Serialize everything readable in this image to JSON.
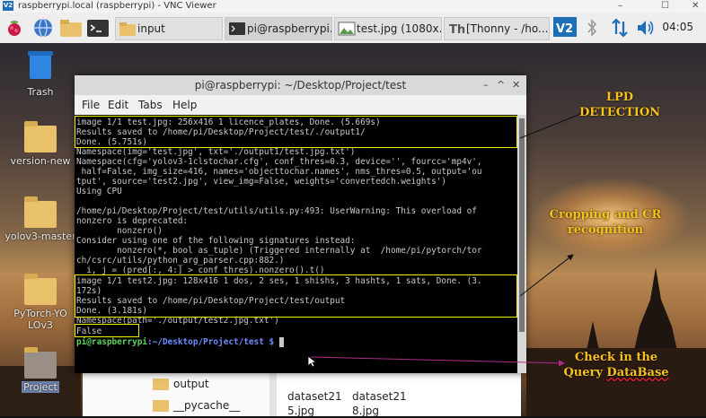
{
  "vnc": {
    "title": "raspberrypi.local (raspberrypi) - VNC Viewer",
    "logo": "V2",
    "minimize": "–",
    "maximize": "☐",
    "close": "✕"
  },
  "taskbar": {
    "buttons": [
      {
        "label": "input",
        "icon": "folder-icon"
      },
      {
        "label": "pi@raspberrypi...",
        "icon": "terminal-icon"
      },
      {
        "label": "test.jpg (1080x...",
        "icon": "image-icon"
      },
      {
        "label": "[Thonny - /ho...",
        "icon": "thonny-icon"
      }
    ],
    "clock": "04:05"
  },
  "desktop": {
    "icons": [
      {
        "label": "Trash"
      },
      {
        "label": "version-new"
      },
      {
        "label": "yolov3-master"
      },
      {
        "label": "PyTorch-YOLOv3"
      },
      {
        "label": "Project"
      }
    ]
  },
  "file_manager": {
    "folders": [
      "output",
      "__pycache__"
    ],
    "files": [
      "dataset215.jpg",
      "dataset218.jpg"
    ]
  },
  "terminal": {
    "title": "pi@raspberrypi: ~/Desktop/Project/test",
    "menu": [
      "File",
      "Edit",
      "Tabs",
      "Help"
    ],
    "lines": [
      "image 1/1 test.jpg: 256x416 1 licence_plates, Done. (5.669s)",
      "Results saved to /home/pi/Desktop/Project/test/./output1/",
      "Done. (5.751s)",
      "Namespace(img='test.jpg', txt='./output1/test.jpg.txt')",
      "Namespace(cfg='yolov3-1clstochar.cfg', conf_thres=0.3, device='', fourcc='mp4v',",
      " half=False, img_size=416, names='objecttochar.names', nms_thres=0.5, output='ou",
      "tput', source='test2.jpg', view_img=False, weights='convertedch.weights')",
      "Using CPU",
      "",
      "/home/pi/Desktop/Project/test/utils/utils.py:493: UserWarning: This overload of",
      "nonzero is deprecated:",
      "        nonzero()",
      "Consider using one of the following signatures instead:",
      "        nonzero(*, bool as_tuple) (Triggered internally at  /home/pi/pytorch/tor",
      "ch/csrc/utils/python_arg_parser.cpp:882.)",
      "  i, j = (pred[:, 4:] > conf_thres).nonzero().t()",
      "image 1/1 test2.jpg: 128x416 1 dos, 2 ses, 1 shishs, 3 hashts, 1 sats, Done. (3.",
      "172s)",
      "Results saved to /home/pi/Desktop/Project/test/output",
      "Done. (3.181s)",
      "Namespace(path='./output/test2.jpg.txt')",
      "False"
    ],
    "prompt_user": "pi@raspberrypi",
    "prompt_path": ":~/Desktop/Project/test $"
  },
  "annotations": {
    "lpd": [
      "LPD",
      "DETECTION"
    ],
    "crop": [
      "Cropping and CR",
      "recognition"
    ],
    "check_a": "Check in the",
    "check_b1": "Query ",
    "check_b2": "DataBase"
  },
  "colors": {
    "annotation": "#f7c21a",
    "highlight_box": "#f0f000",
    "prompt_user": "#5fd35f",
    "prompt_path": "#6f8cff"
  }
}
